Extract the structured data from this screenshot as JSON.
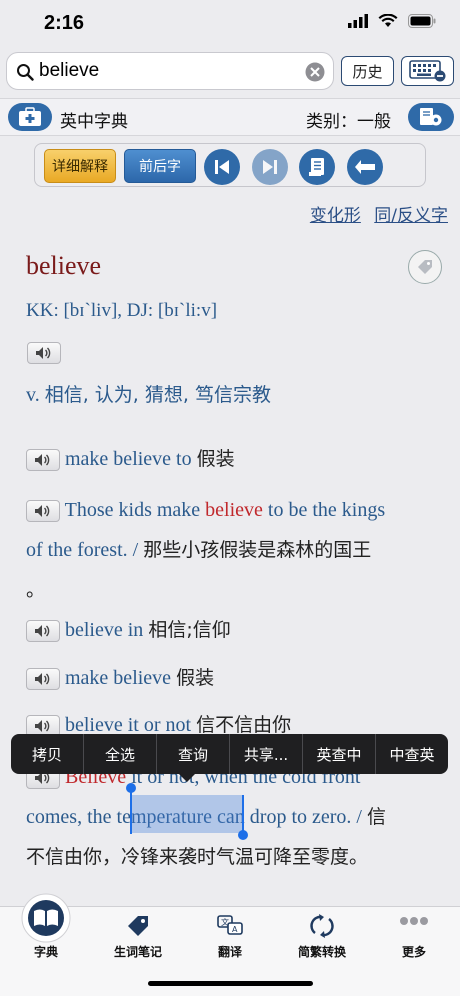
{
  "status": {
    "time": "2:16"
  },
  "search": {
    "query": "believe",
    "history_label": "历史"
  },
  "titlebar": {
    "dict_name": "英中字典",
    "category": "类别：一般"
  },
  "toolbar": {
    "detail_label": "详细解释",
    "around_label": "前后字"
  },
  "links": {
    "forms": "变化形",
    "synonyms": "同/反义字"
  },
  "entry": {
    "headword": "believe",
    "phonetic": "KK: [bɪˋliv], DJ: [bɪˋli:v]",
    "pos": "v.",
    "definition": "相信, 认为, 猜想, 笃信宗教"
  },
  "phrases": [
    {
      "en": "make believe to",
      "cn": "假装"
    },
    {
      "en": "believe in",
      "cn": "相信;信仰"
    },
    {
      "en": "make believe",
      "cn": "假装"
    },
    {
      "en": "believe it or not",
      "cn": "信不信由你"
    }
  ],
  "example1": {
    "pre": "Those kids make ",
    "hl": "believe",
    "post": " to be the kings",
    "line2_en": "of the forest. / ",
    "line2_cn": "那些小孩假装是森林的国王",
    "line3": "。"
  },
  "example2": {
    "hl": "Believe",
    "line1_rest": " it or not, when the cold front",
    "line2_pre": "comes, the ",
    "line2_sel": "temperature",
    "line2_post": " can drop to zero. / ",
    "line2_cn": "信",
    "line3_cn": "不信由你，冷锋来袭时气温可降至零度。"
  },
  "context_menu": [
    "拷贝",
    "全选",
    "查询",
    "共享...",
    "英查中",
    "中查英"
  ],
  "tabs": [
    {
      "label": "字典",
      "icon": "book-icon"
    },
    {
      "label": "生词笔记",
      "icon": "tag-icon"
    },
    {
      "label": "翻译",
      "icon": "translate-icon"
    },
    {
      "label": "简繁转换",
      "icon": "convert-icon"
    },
    {
      "label": "更多",
      "icon": "more-icon"
    }
  ],
  "colors": {
    "accent": "#2f6aa8",
    "headword": "#7a1a1a",
    "english": "#2b5a8c",
    "highlight": "#c0282c"
  }
}
